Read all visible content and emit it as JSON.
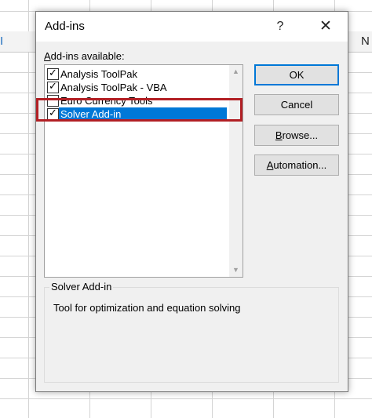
{
  "spreadsheet": {
    "col_left_letter": "I",
    "col_right_letter": "N"
  },
  "dialog": {
    "title": "Add-ins",
    "help_label": "?",
    "close_label": "✕",
    "available_label_prefix": "",
    "available_label_underlined": "A",
    "available_label_rest": "dd-ins available:",
    "items": [
      {
        "label": "Analysis ToolPak",
        "checked": true,
        "selected": false
      },
      {
        "label": "Analysis ToolPak - VBA",
        "checked": true,
        "selected": false
      },
      {
        "label": "Euro Currency Tools",
        "checked": false,
        "selected": false
      },
      {
        "label": "Solver Add-in",
        "checked": true,
        "selected": true
      }
    ],
    "buttons": {
      "ok": "OK",
      "cancel": "Cancel",
      "browse_underlined": "B",
      "browse_rest": "rowse...",
      "automation_underlined": "A",
      "automation_rest": "utomation..."
    },
    "description": {
      "group_title": "Solver Add-in",
      "text": "Tool for optimization and equation solving"
    },
    "accent_color": "#0078d7",
    "highlight_color": "#b21f24"
  }
}
